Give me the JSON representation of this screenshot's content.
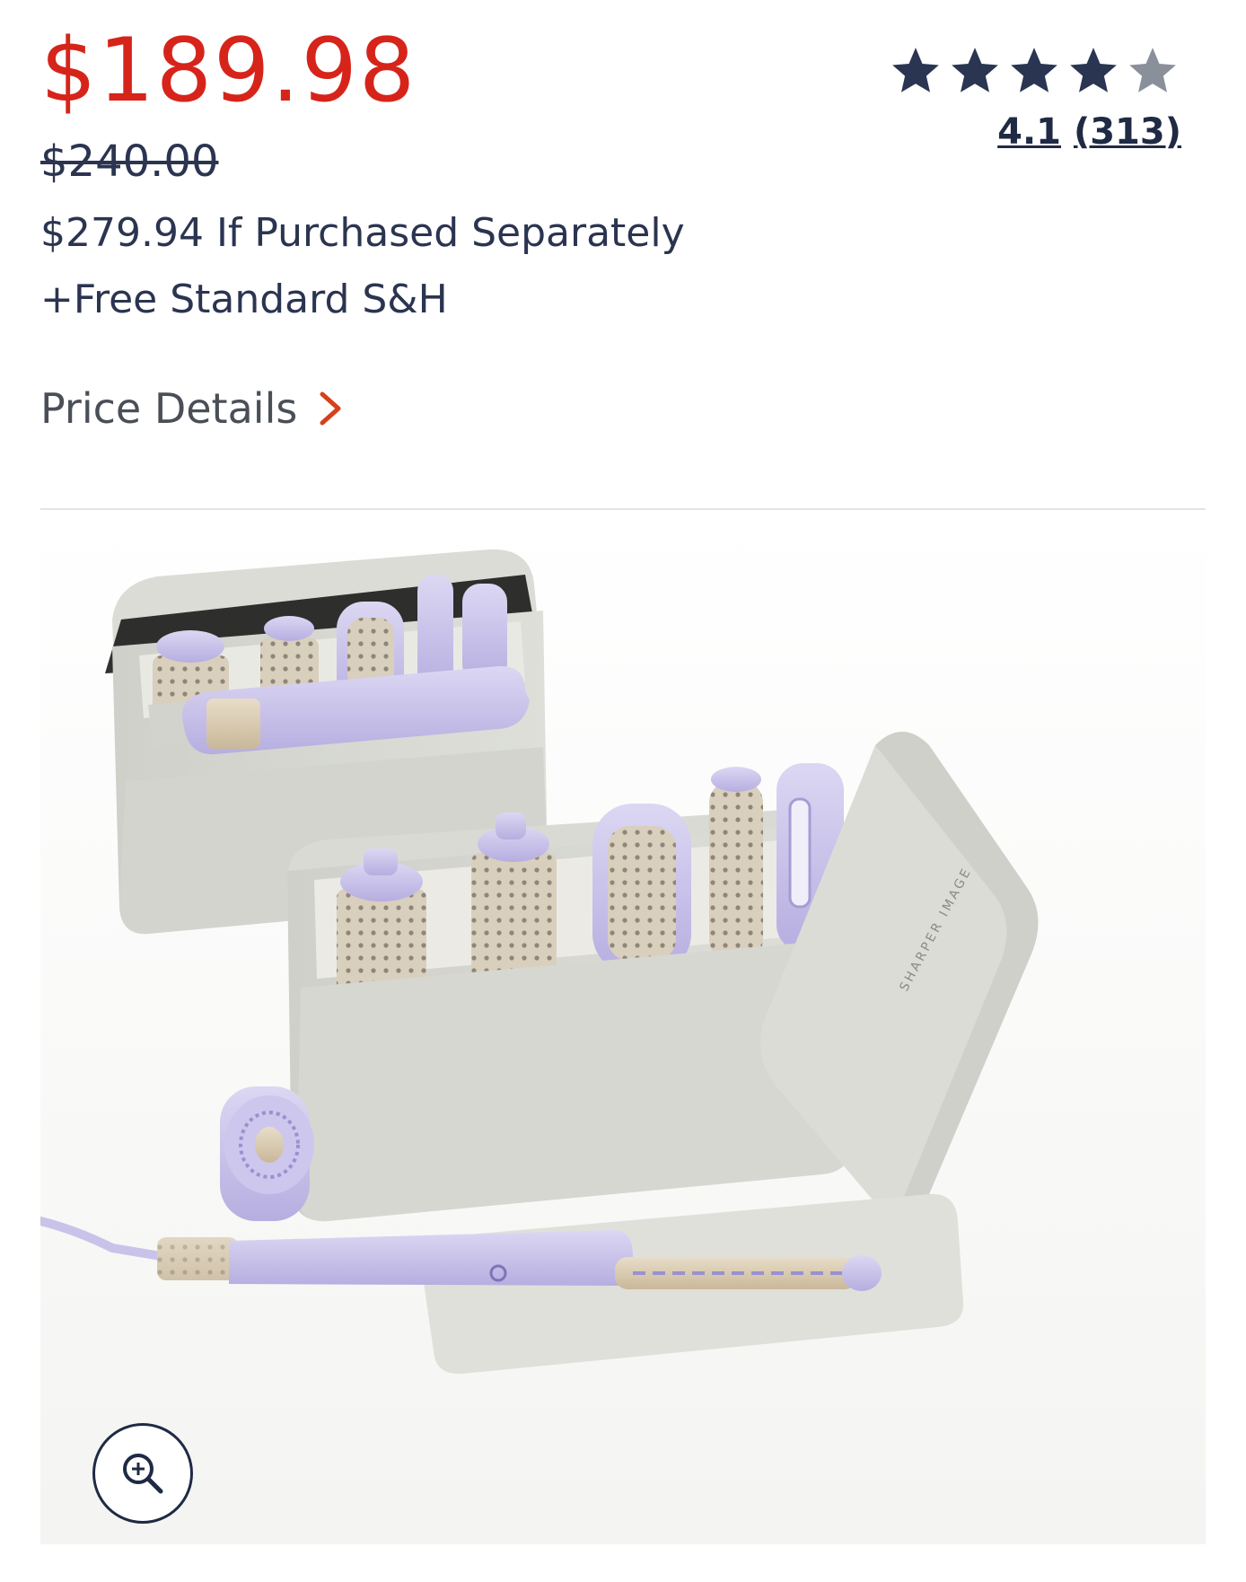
{
  "price": {
    "sale": "$189.98",
    "original": "$240.00",
    "separately": "$279.94 If Purchased Separately",
    "shipping": "+Free Standard S&H",
    "details_label": "Price Details"
  },
  "rating": {
    "value": "4.1",
    "count": "(313)",
    "stars_filled": 4,
    "stars_total": 5
  },
  "product_image": {
    "brand_mark": "SHARPER IMAGE"
  },
  "colors": {
    "sale": "#d6241a",
    "navy": "#1f2a44",
    "chevron": "#d6401a",
    "star_filled": "#2a3552",
    "star_empty": "#8a9099",
    "case": "#d7d8d2",
    "lavender": "#c8c2ea"
  },
  "icons": {
    "chevron": "chevron-right-icon",
    "star": "star-icon",
    "zoom": "zoom-in-icon"
  }
}
